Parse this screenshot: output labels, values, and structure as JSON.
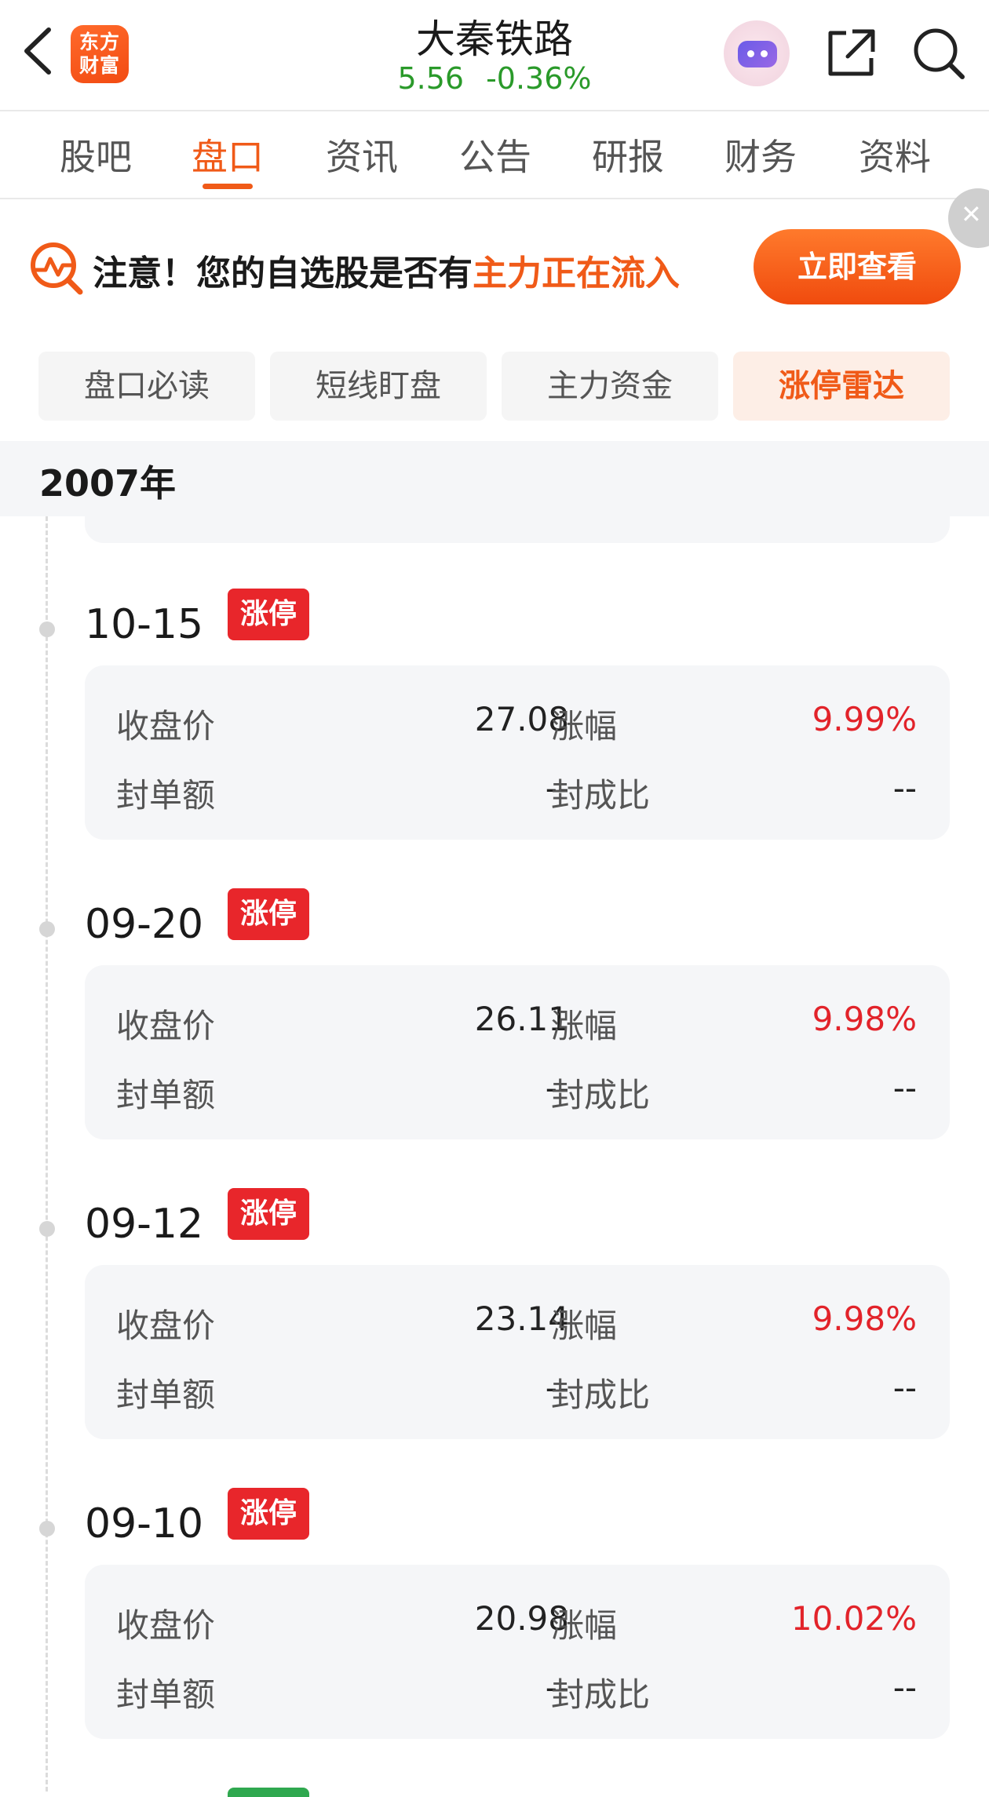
{
  "header": {
    "logo_line1": "东方",
    "logo_line2": "财富",
    "stock_name": "大秦铁路",
    "price": "5.56",
    "change": "-0.36%"
  },
  "tabs": [
    "股吧",
    "盘口",
    "资讯",
    "公告",
    "研报",
    "财务",
    "资料"
  ],
  "active_tab": "盘口",
  "banner": {
    "text_prefix": "注意！您的自选股是否有",
    "text_highlight": "主力正在流入",
    "button": "立即查看"
  },
  "subtabs": [
    "盘口必读",
    "短线盯盘",
    "主力资金",
    "涨停雷达"
  ],
  "active_subtab": "涨停雷达",
  "year": "2007年",
  "labels": {
    "close_price": "收盘价",
    "change_pct": "涨幅",
    "seal_amount": "封单额",
    "seal_ratio": "封成比"
  },
  "entries": [
    {
      "date": "10-15",
      "badge": "涨停",
      "close": "27.08",
      "change": "9.99%",
      "seal_amount": "--",
      "seal_ratio": "--"
    },
    {
      "date": "09-20",
      "badge": "涨停",
      "close": "26.11",
      "change": "9.98%",
      "seal_amount": "--",
      "seal_ratio": "--"
    },
    {
      "date": "09-12",
      "badge": "涨停",
      "close": "23.14",
      "change": "9.98%",
      "seal_amount": "--",
      "seal_ratio": "--"
    },
    {
      "date": "09-10",
      "badge": "涨停",
      "close": "20.98",
      "change": "10.02%",
      "seal_amount": "--",
      "seal_ratio": "--"
    }
  ],
  "colors": {
    "accent": "#f05a18",
    "up_red": "#e2232a",
    "quote_green": "#2a9a2a",
    "badge_red": "#e8262b"
  }
}
